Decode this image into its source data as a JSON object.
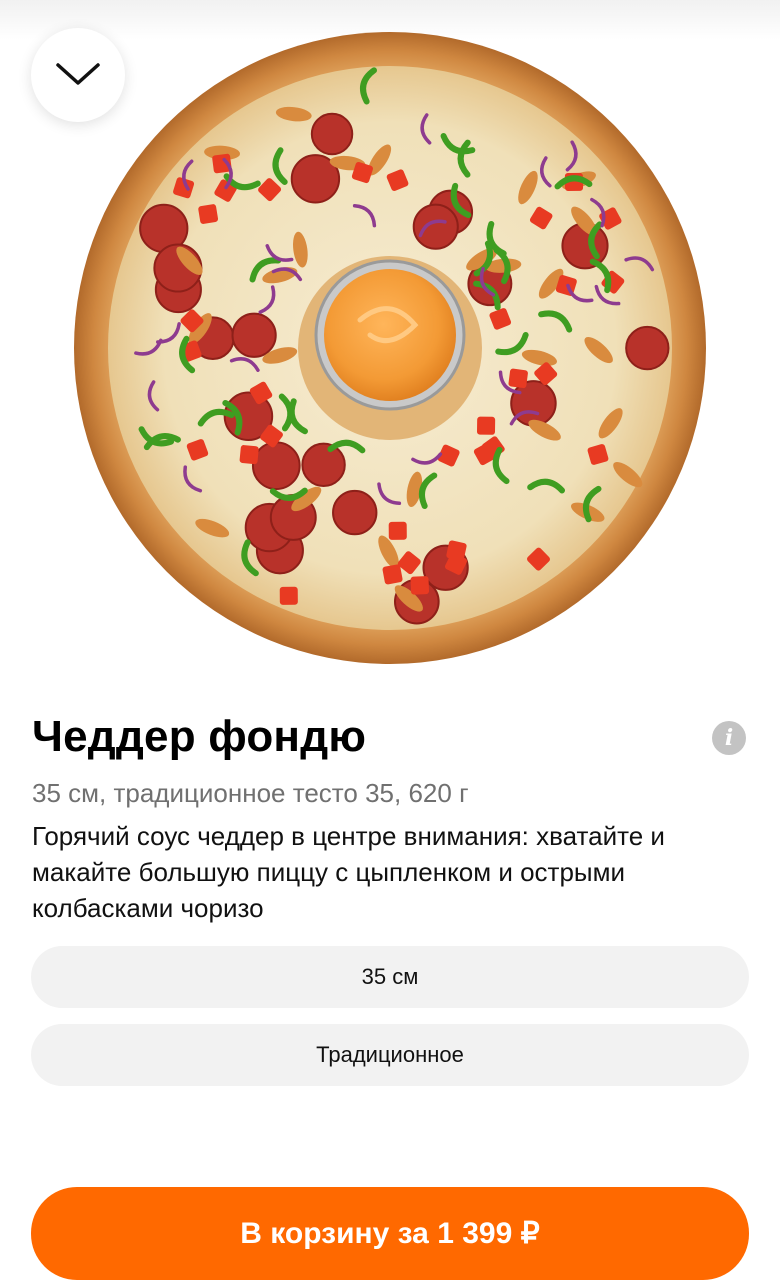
{
  "header": {
    "collapse_icon": "chevron-down-icon"
  },
  "product": {
    "image_icon": "pizza-image",
    "name": "Чеддер фондю",
    "info_icon": "info-icon",
    "info_glyph": "i",
    "meta": "35 см, традиционное тесто 35, 620 г",
    "description": "Горячий соус чеддер в центре внимания: хватайте и макайте большую пиццу с цыпленком и острыми колбасками чоризо"
  },
  "options": {
    "size": "35 см",
    "dough": "Традиционное"
  },
  "cart_button": {
    "label": "В корзину за 1 399 ₽"
  },
  "colors": {
    "accent": "#ff6900",
    "selector_bg": "#f2f2f2",
    "muted_text": "#707070"
  }
}
